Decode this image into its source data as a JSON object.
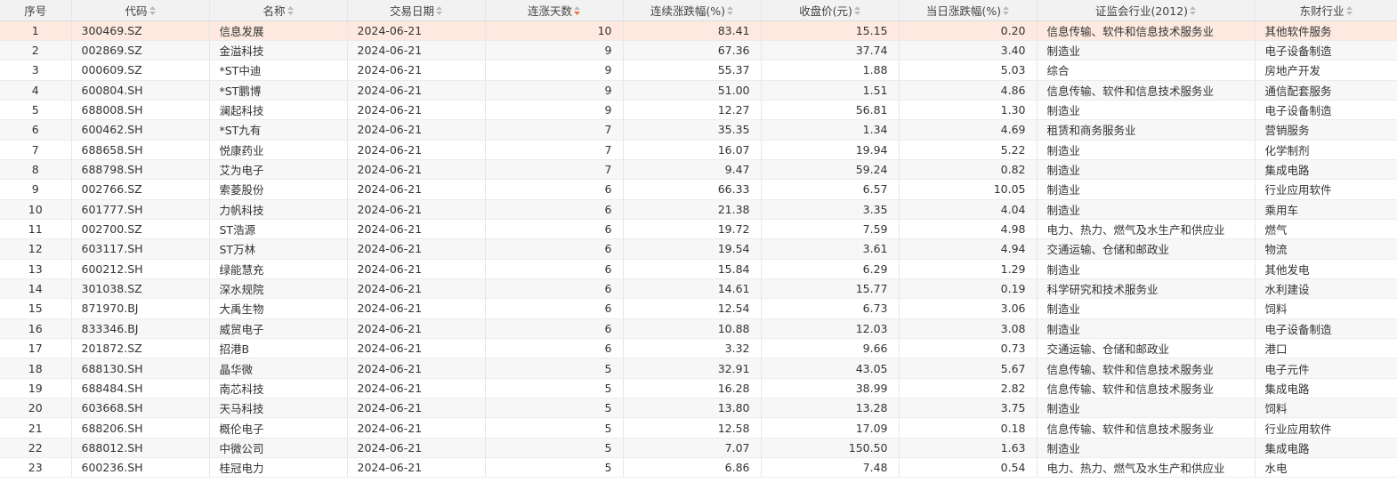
{
  "table": {
    "columns": [
      {
        "label": "序号",
        "sortable": false
      },
      {
        "label": "代码",
        "sortable": true
      },
      {
        "label": "名称",
        "sortable": true
      },
      {
        "label": "交易日期",
        "sortable": true
      },
      {
        "label": "连涨天数",
        "sortable": true,
        "sorted": "desc"
      },
      {
        "label": "连续涨跌幅(%)",
        "sortable": true
      },
      {
        "label": "收盘价(元)",
        "sortable": true
      },
      {
        "label": "当日涨跌幅(%)",
        "sortable": true
      },
      {
        "label": "证监会行业(2012)",
        "sortable": true
      },
      {
        "label": "东财行业",
        "sortable": true
      }
    ],
    "accent_sort_color": "#e8783c",
    "sort_color": "#bbbbbb",
    "highlight_color": "#fde9df",
    "rows": [
      [
        "1",
        "300469.SZ",
        "信息发展",
        "2024-06-21",
        "10",
        "83.41",
        "15.15",
        "0.20",
        "信息传输、软件和信息技术服务业",
        "其他软件服务"
      ],
      [
        "2",
        "002869.SZ",
        "金溢科技",
        "2024-06-21",
        "9",
        "67.36",
        "37.74",
        "3.40",
        "制造业",
        "电子设备制造"
      ],
      [
        "3",
        "000609.SZ",
        "*ST中迪",
        "2024-06-21",
        "9",
        "55.37",
        "1.88",
        "5.03",
        "综合",
        "房地产开发"
      ],
      [
        "4",
        "600804.SH",
        "*ST鹏博",
        "2024-06-21",
        "9",
        "51.00",
        "1.51",
        "4.86",
        "信息传输、软件和信息技术服务业",
        "通信配套服务"
      ],
      [
        "5",
        "688008.SH",
        "澜起科技",
        "2024-06-21",
        "9",
        "12.27",
        "56.81",
        "1.30",
        "制造业",
        "电子设备制造"
      ],
      [
        "6",
        "600462.SH",
        "*ST九有",
        "2024-06-21",
        "7",
        "35.35",
        "1.34",
        "4.69",
        "租赁和商务服务业",
        "营销服务"
      ],
      [
        "7",
        "688658.SH",
        "悦康药业",
        "2024-06-21",
        "7",
        "16.07",
        "19.94",
        "5.22",
        "制造业",
        "化学制剂"
      ],
      [
        "8",
        "688798.SH",
        "艾为电子",
        "2024-06-21",
        "7",
        "9.47",
        "59.24",
        "0.82",
        "制造业",
        "集成电路"
      ],
      [
        "9",
        "002766.SZ",
        "索菱股份",
        "2024-06-21",
        "6",
        "66.33",
        "6.57",
        "10.05",
        "制造业",
        "行业应用软件"
      ],
      [
        "10",
        "601777.SH",
        "力帆科技",
        "2024-06-21",
        "6",
        "21.38",
        "3.35",
        "4.04",
        "制造业",
        "乘用车"
      ],
      [
        "11",
        "002700.SZ",
        "ST浩源",
        "2024-06-21",
        "6",
        "19.72",
        "7.59",
        "4.98",
        "电力、热力、燃气及水生产和供应业",
        "燃气"
      ],
      [
        "12",
        "603117.SH",
        "ST万林",
        "2024-06-21",
        "6",
        "19.54",
        "3.61",
        "4.94",
        "交通运输、仓储和邮政业",
        "物流"
      ],
      [
        "13",
        "600212.SH",
        "绿能慧充",
        "2024-06-21",
        "6",
        "15.84",
        "6.29",
        "1.29",
        "制造业",
        "其他发电"
      ],
      [
        "14",
        "301038.SZ",
        "深水规院",
        "2024-06-21",
        "6",
        "14.61",
        "15.77",
        "0.19",
        "科学研究和技术服务业",
        "水利建设"
      ],
      [
        "15",
        "871970.BJ",
        "大禹生物",
        "2024-06-21",
        "6",
        "12.54",
        "6.73",
        "3.06",
        "制造业",
        "饲料"
      ],
      [
        "16",
        "833346.BJ",
        "威贸电子",
        "2024-06-21",
        "6",
        "10.88",
        "12.03",
        "3.08",
        "制造业",
        "电子设备制造"
      ],
      [
        "17",
        "201872.SZ",
        "招港B",
        "2024-06-21",
        "6",
        "3.32",
        "9.66",
        "0.73",
        "交通运输、仓储和邮政业",
        "港口"
      ],
      [
        "18",
        "688130.SH",
        "晶华微",
        "2024-06-21",
        "5",
        "32.91",
        "43.05",
        "5.67",
        "信息传输、软件和信息技术服务业",
        "电子元件"
      ],
      [
        "19",
        "688484.SH",
        "南芯科技",
        "2024-06-21",
        "5",
        "16.28",
        "38.99",
        "2.82",
        "信息传输、软件和信息技术服务业",
        "集成电路"
      ],
      [
        "20",
        "603668.SH",
        "天马科技",
        "2024-06-21",
        "5",
        "13.80",
        "13.28",
        "3.75",
        "制造业",
        "饲料"
      ],
      [
        "21",
        "688206.SH",
        "概伦电子",
        "2024-06-21",
        "5",
        "12.58",
        "17.09",
        "0.18",
        "信息传输、软件和信息技术服务业",
        "行业应用软件"
      ],
      [
        "22",
        "688012.SH",
        "中微公司",
        "2024-06-21",
        "5",
        "7.07",
        "150.50",
        "1.63",
        "制造业",
        "集成电路"
      ],
      [
        "23",
        "600236.SH",
        "桂冠电力",
        "2024-06-21",
        "5",
        "6.86",
        "7.48",
        "0.54",
        "电力、热力、燃气及水生产和供应业",
        "水电"
      ]
    ]
  }
}
